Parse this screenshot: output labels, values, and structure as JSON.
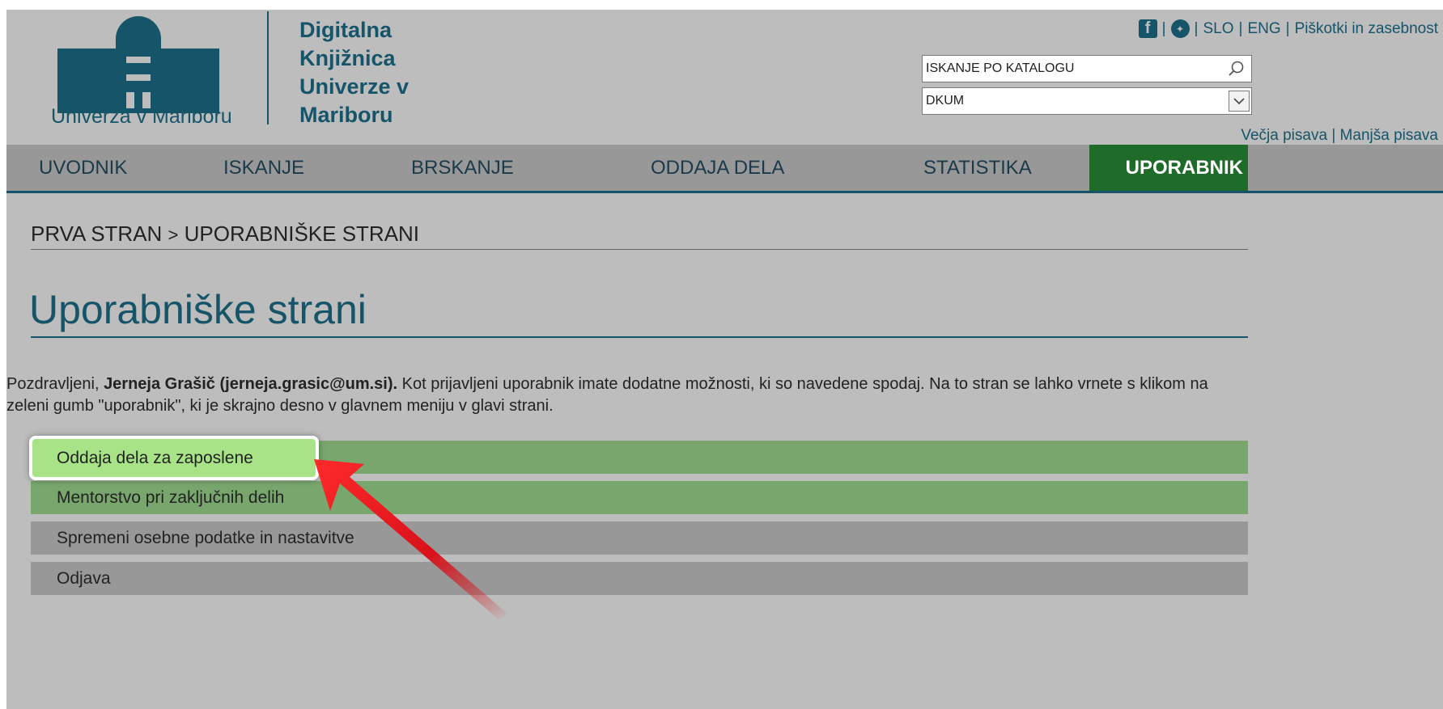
{
  "header": {
    "university_name": "Univerza v Mariboru",
    "library_name_lines": [
      "Digitalna",
      "Knjižnica",
      "Univerze v",
      "Mariboru"
    ],
    "icons": [
      "facebook-icon",
      "twitter-icon"
    ],
    "lang_slo": "SLO",
    "lang_eng": "ENG",
    "cookies_link": "Piškotki in zasebnost",
    "search_value": "ISKANJE PO KATALOGU",
    "select_value": "DKUM",
    "font_larger": "Večja pisava",
    "font_smaller": "Manjša pisava",
    "separator": "|"
  },
  "nav": {
    "items": [
      "UVODNIK",
      "ISKANJE",
      "BRSKANJE",
      "ODDAJA DELA",
      "STATISTIKA"
    ],
    "active": "UPORABNIK"
  },
  "breadcrumb": {
    "home": "PRVA STRAN",
    "separator": ">",
    "current": "UPORABNIŠKE STRANI"
  },
  "main": {
    "title": "Uporabniške strani",
    "intro_prefix": "Pozdravljeni, ",
    "intro_user": "Jerneja Grašič (jerneja.grasic@um.si).",
    "intro_rest": " Kot prijavljeni uporabnik imate dodatne možnosti, ki so navedene spodaj. Na to stran se lahko vrnete s klikom na zeleni gumb \"uporabnik\", ki je skrajno desno v glavnem meniju v glavi strani.",
    "menu": [
      "Oddaja dela za zaposlene",
      "Mentorstvo pri zaključnih delih",
      "Spremeni osebne podatke in nastavitve",
      "Odjava"
    ]
  },
  "colors": {
    "brand": "#155469",
    "active_nav": "#1e6b2a",
    "menu_green": "#78a66c",
    "menu_gray": "#989898",
    "highlight": "#a8e487",
    "annotation_arrow": "#e0141a"
  }
}
